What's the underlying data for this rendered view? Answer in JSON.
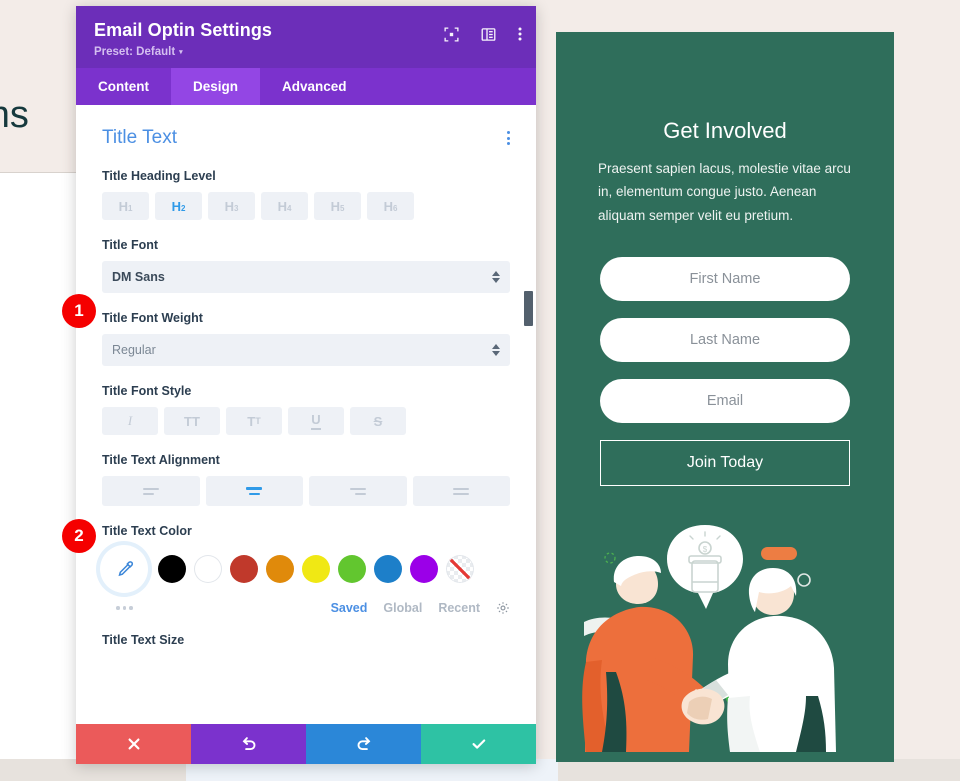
{
  "background": {
    "heading_fragment": "aigns"
  },
  "modal": {
    "title": "Email Optin Settings",
    "preset_label": "Preset: Default",
    "preset_caret": "▾",
    "header_icons": [
      {
        "name": "fullscreen-icon"
      },
      {
        "name": "panel-layout-icon"
      },
      {
        "name": "kebab-menu-icon"
      }
    ],
    "tabs": [
      {
        "label": "Content",
        "active": false
      },
      {
        "label": "Design",
        "active": true
      },
      {
        "label": "Advanced",
        "active": false
      }
    ],
    "section": {
      "title": "Title Text"
    },
    "fields": {
      "heading_level": {
        "label": "Title Heading Level",
        "options": [
          "H1",
          "H2",
          "H3",
          "H4",
          "H5",
          "H6"
        ],
        "selected": "H2"
      },
      "font": {
        "label": "Title Font",
        "value": "DM Sans"
      },
      "font_weight": {
        "label": "Title Font Weight",
        "value": "Regular"
      },
      "font_style": {
        "label": "Title Font Style",
        "options": [
          "Italic",
          "Uppercase",
          "Small Caps",
          "Underline",
          "Strikethrough"
        ],
        "selected": ""
      },
      "text_alignment": {
        "label": "Title Text Alignment",
        "options": [
          "Left",
          "Center",
          "Right",
          "Justify"
        ],
        "selected": "Center"
      },
      "text_color": {
        "label": "Title Text Color",
        "swatches": [
          "#000000",
          "#ffffff",
          "#c0392b",
          "#e08a0b",
          "#f0e814",
          "#62c62f",
          "#1d7fc9",
          "#9b00e8"
        ],
        "transparent_label": "Transparent",
        "tabs": [
          {
            "label": "Saved",
            "active": true
          },
          {
            "label": "Global",
            "active": false
          },
          {
            "label": "Recent",
            "active": false
          }
        ],
        "settings_icon": "gear-icon"
      },
      "text_size": {
        "label": "Title Text Size"
      }
    },
    "footer_actions": [
      {
        "name": "cancel-button",
        "icon": "✕",
        "color": "#eb5a5a"
      },
      {
        "name": "undo-button",
        "icon": "↺",
        "color": "#7b32cd"
      },
      {
        "name": "redo-button",
        "icon": "↻",
        "color": "#2b87d8"
      },
      {
        "name": "save-button",
        "icon": "✓",
        "color": "#2ec2a4"
      }
    ]
  },
  "callouts": [
    {
      "number": "1"
    },
    {
      "number": "2"
    }
  ],
  "preview": {
    "title": "Get Involved",
    "body": "Praesent sapien lacus, molestie vitae arcu in, elementum congue justo. Aenean aliquam semper velit eu pretium.",
    "fields": [
      {
        "placeholder": "First Name"
      },
      {
        "placeholder": "Last Name"
      },
      {
        "placeholder": "Email"
      }
    ],
    "submit_label": "Join Today",
    "background_color": "#2f6e5b"
  }
}
